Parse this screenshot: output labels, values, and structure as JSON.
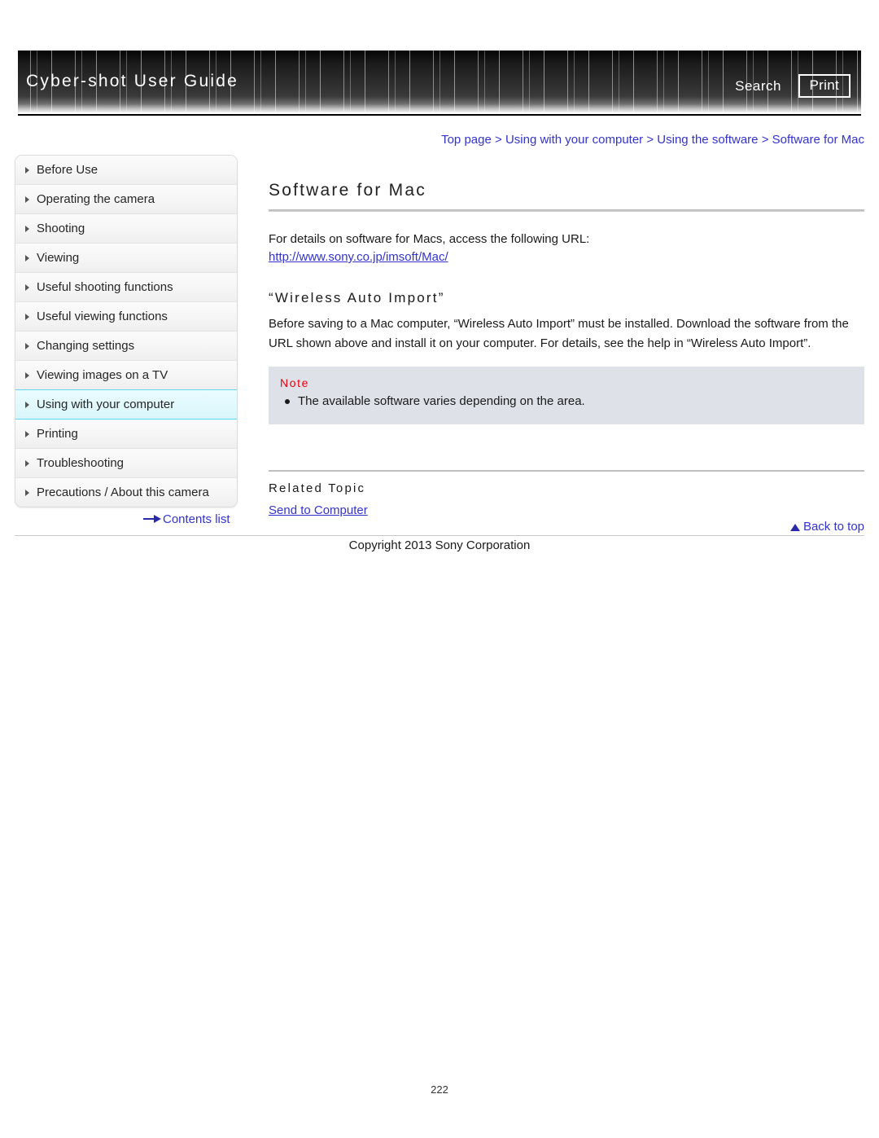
{
  "header": {
    "title": "Cyber-shot User Guide",
    "search_label": "Search",
    "print_label": "Print"
  },
  "breadcrumb": {
    "full": "Top page > Using with your computer > Using the software > Software for Mac",
    "items": [
      "Top page",
      "Using with your computer",
      "Using the software",
      "Software for Mac"
    ],
    "separator": ">"
  },
  "sidebar": {
    "items": [
      {
        "label": "Before Use",
        "active": false
      },
      {
        "label": "Operating the camera",
        "active": false
      },
      {
        "label": "Shooting",
        "active": false
      },
      {
        "label": "Viewing",
        "active": false
      },
      {
        "label": "Useful shooting functions",
        "active": false
      },
      {
        "label": "Useful viewing functions",
        "active": false
      },
      {
        "label": "Changing settings",
        "active": false
      },
      {
        "label": "Viewing images on a TV",
        "active": false
      },
      {
        "label": "Using with your computer",
        "active": true
      },
      {
        "label": "Printing",
        "active": false
      },
      {
        "label": "Troubleshooting",
        "active": false
      },
      {
        "label": "Precautions / About this camera",
        "active": false
      }
    ],
    "contents_list_label": "Contents list"
  },
  "main": {
    "page_title": "Software for Mac",
    "intro_text": "For details on software for Macs, access the following URL:",
    "url_link": "http://www.sony.co.jp/imsoft/Mac/",
    "subheading": "“Wireless Auto Import”",
    "body_paragraph": "Before saving to a Mac computer, “Wireless Auto Import” must be installed. Download the software from the URL shown above and install it on your computer. For details, see the help in “Wireless Auto Import”.",
    "note": {
      "label": "Note",
      "items": [
        "The available software varies depending on the area."
      ]
    },
    "related": {
      "label": "Related Topic",
      "links": [
        "Send to Computer"
      ]
    }
  },
  "footer": {
    "back_to_top_label": "Back to top",
    "copyright": "Copyright 2013 Sony Corporation",
    "page_number": "222"
  },
  "colors": {
    "link": "#3333CC",
    "note_label": "#E8000D",
    "note_background": "#DFE1E8",
    "active_nav_background": "#D9F6FB",
    "active_nav_border": "#63D6EF",
    "banner_background": "#1C1C1C"
  }
}
